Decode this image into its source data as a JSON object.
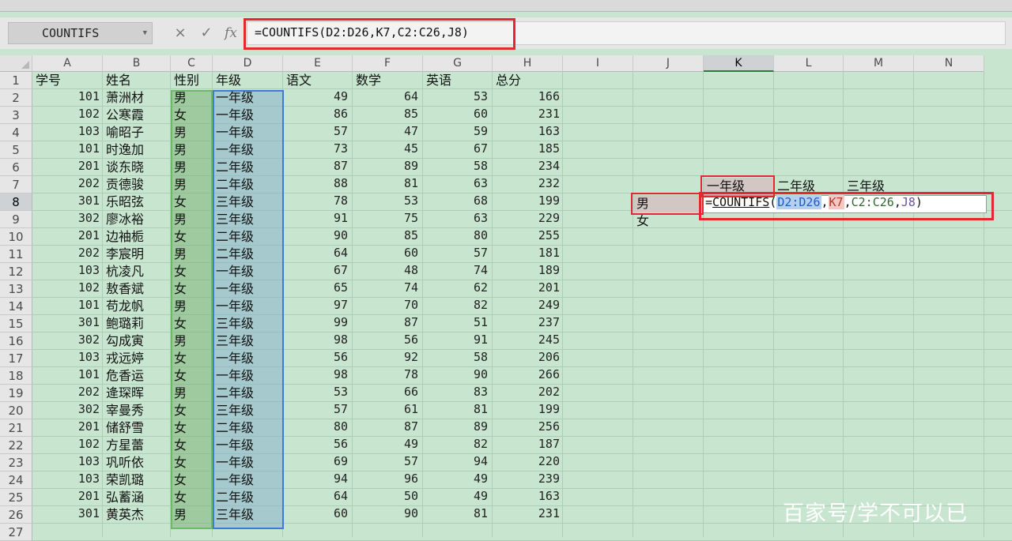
{
  "formula_bar": {
    "name_box": "COUNTIFS",
    "cancel_symbol": "×",
    "enter_symbol": "✓",
    "fx_label": "fx",
    "formula": "=COUNTIFS(D2:D26,K7,C2:C26,J8)"
  },
  "columns": [
    "A",
    "B",
    "C",
    "D",
    "E",
    "F",
    "G",
    "H",
    "I",
    "J",
    "K",
    "L",
    "M",
    "N"
  ],
  "active_column": "K",
  "active_row": 8,
  "headers": {
    "id": "学号",
    "name": "姓名",
    "gender": "性别",
    "grade": "年级",
    "chinese": "语文",
    "math": "数学",
    "english": "英语",
    "total": "总分"
  },
  "rows": [
    {
      "id": "101",
      "name": "萧洲材",
      "gender": "男",
      "grade": "一年级",
      "chinese": "49",
      "math": "64",
      "english": "53",
      "total": "166"
    },
    {
      "id": "102",
      "name": "公寒霞",
      "gender": "女",
      "grade": "一年级",
      "chinese": "86",
      "math": "85",
      "english": "60",
      "total": "231"
    },
    {
      "id": "103",
      "name": "喻昭子",
      "gender": "男",
      "grade": "一年级",
      "chinese": "57",
      "math": "47",
      "english": "59",
      "total": "163"
    },
    {
      "id": "101",
      "name": "时逸加",
      "gender": "男",
      "grade": "一年级",
      "chinese": "73",
      "math": "45",
      "english": "67",
      "total": "185"
    },
    {
      "id": "201",
      "name": "谈东晓",
      "gender": "男",
      "grade": "二年级",
      "chinese": "87",
      "math": "89",
      "english": "58",
      "total": "234"
    },
    {
      "id": "202",
      "name": "贡德骏",
      "gender": "男",
      "grade": "二年级",
      "chinese": "88",
      "math": "81",
      "english": "63",
      "total": "232"
    },
    {
      "id": "301",
      "name": "乐昭弦",
      "gender": "女",
      "grade": "三年级",
      "chinese": "78",
      "math": "53",
      "english": "68",
      "total": "199"
    },
    {
      "id": "302",
      "name": "廖冰裕",
      "gender": "男",
      "grade": "三年级",
      "chinese": "91",
      "math": "75",
      "english": "63",
      "total": "229"
    },
    {
      "id": "201",
      "name": "边袖栀",
      "gender": "女",
      "grade": "二年级",
      "chinese": "90",
      "math": "85",
      "english": "80",
      "total": "255"
    },
    {
      "id": "202",
      "name": "李宸明",
      "gender": "男",
      "grade": "二年级",
      "chinese": "64",
      "math": "60",
      "english": "57",
      "total": "181"
    },
    {
      "id": "103",
      "name": "杭凌凡",
      "gender": "女",
      "grade": "一年级",
      "chinese": "67",
      "math": "48",
      "english": "74",
      "total": "189"
    },
    {
      "id": "102",
      "name": "敖香斌",
      "gender": "女",
      "grade": "一年级",
      "chinese": "65",
      "math": "74",
      "english": "62",
      "total": "201"
    },
    {
      "id": "101",
      "name": "苟龙帆",
      "gender": "男",
      "grade": "一年级",
      "chinese": "97",
      "math": "70",
      "english": "82",
      "total": "249"
    },
    {
      "id": "301",
      "name": "鲍璐莉",
      "gender": "女",
      "grade": "三年级",
      "chinese": "99",
      "math": "87",
      "english": "51",
      "total": "237"
    },
    {
      "id": "302",
      "name": "勾成寅",
      "gender": "男",
      "grade": "三年级",
      "chinese": "98",
      "math": "56",
      "english": "91",
      "total": "245"
    },
    {
      "id": "103",
      "name": "戎远婷",
      "gender": "女",
      "grade": "一年级",
      "chinese": "56",
      "math": "92",
      "english": "58",
      "total": "206"
    },
    {
      "id": "101",
      "name": "危香运",
      "gender": "女",
      "grade": "一年级",
      "chinese": "98",
      "math": "78",
      "english": "90",
      "total": "266"
    },
    {
      "id": "202",
      "name": "逄琛晖",
      "gender": "男",
      "grade": "二年级",
      "chinese": "53",
      "math": "66",
      "english": "83",
      "total": "202"
    },
    {
      "id": "302",
      "name": "宰曼秀",
      "gender": "女",
      "grade": "三年级",
      "chinese": "57",
      "math": "61",
      "english": "81",
      "total": "199"
    },
    {
      "id": "201",
      "name": "储舒雪",
      "gender": "女",
      "grade": "二年级",
      "chinese": "80",
      "math": "87",
      "english": "89",
      "total": "256"
    },
    {
      "id": "102",
      "name": "方星蕾",
      "gender": "女",
      "grade": "一年级",
      "chinese": "56",
      "math": "49",
      "english": "82",
      "total": "187"
    },
    {
      "id": "103",
      "name": "巩听依",
      "gender": "女",
      "grade": "一年级",
      "chinese": "69",
      "math": "57",
      "english": "94",
      "total": "220"
    },
    {
      "id": "103",
      "name": "荣凯璐",
      "gender": "女",
      "grade": "一年级",
      "chinese": "94",
      "math": "96",
      "english": "49",
      "total": "239"
    },
    {
      "id": "201",
      "name": "弘蓄涵",
      "gender": "女",
      "grade": "二年级",
      "chinese": "64",
      "math": "50",
      "english": "49",
      "total": "163"
    },
    {
      "id": "301",
      "name": "黄英杰",
      "gender": "男",
      "grade": "三年级",
      "chinese": "60",
      "math": "90",
      "english": "81",
      "total": "231"
    }
  ],
  "summary": {
    "grade_headers": [
      "一年级",
      "二年级",
      "三年级"
    ],
    "gender_labels": [
      "男",
      "女"
    ]
  },
  "cell_edit": {
    "prefix": "=",
    "func": "COUNTIFS",
    "open": "(",
    "arg1": "D2:D26",
    "arg2": "K7",
    "arg3": "C2:C26",
    "arg4": "J8",
    "close": ")",
    "comma": ","
  },
  "watermark": "百家号/学不可以已",
  "colors": {
    "sheet_bg": "#c8e6cf",
    "highlight_red": "#e3282f",
    "selection_blue": "#3e7bd8",
    "selection_green": "#6fb86a"
  }
}
